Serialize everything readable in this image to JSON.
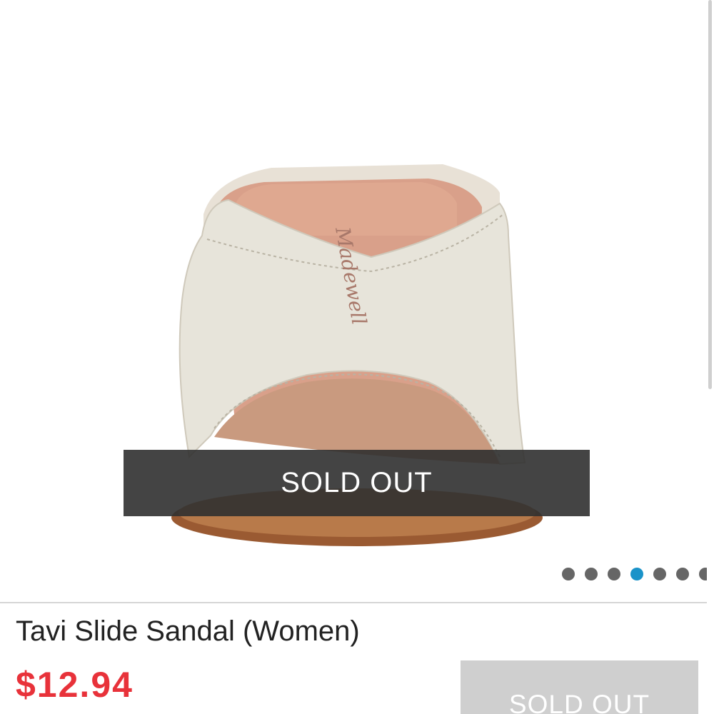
{
  "image_banner": {
    "status_label": "SOLD OUT"
  },
  "image_brand_stamp": "Madewell",
  "carousel": {
    "dots": [
      "inactive",
      "inactive",
      "inactive",
      "active",
      "inactive",
      "inactive",
      "inactive"
    ],
    "active_index": 3,
    "count": 7
  },
  "product": {
    "title": "Tavi Slide Sandal (Women)",
    "price": "$12.94",
    "button_label": "SOLD OUT"
  },
  "colors": {
    "price": "#e8323a",
    "active_dot": "#1a93c9",
    "inactive_dot": "#666666",
    "banner_bg": "#303030",
    "button_bg": "#cfcfcf"
  }
}
